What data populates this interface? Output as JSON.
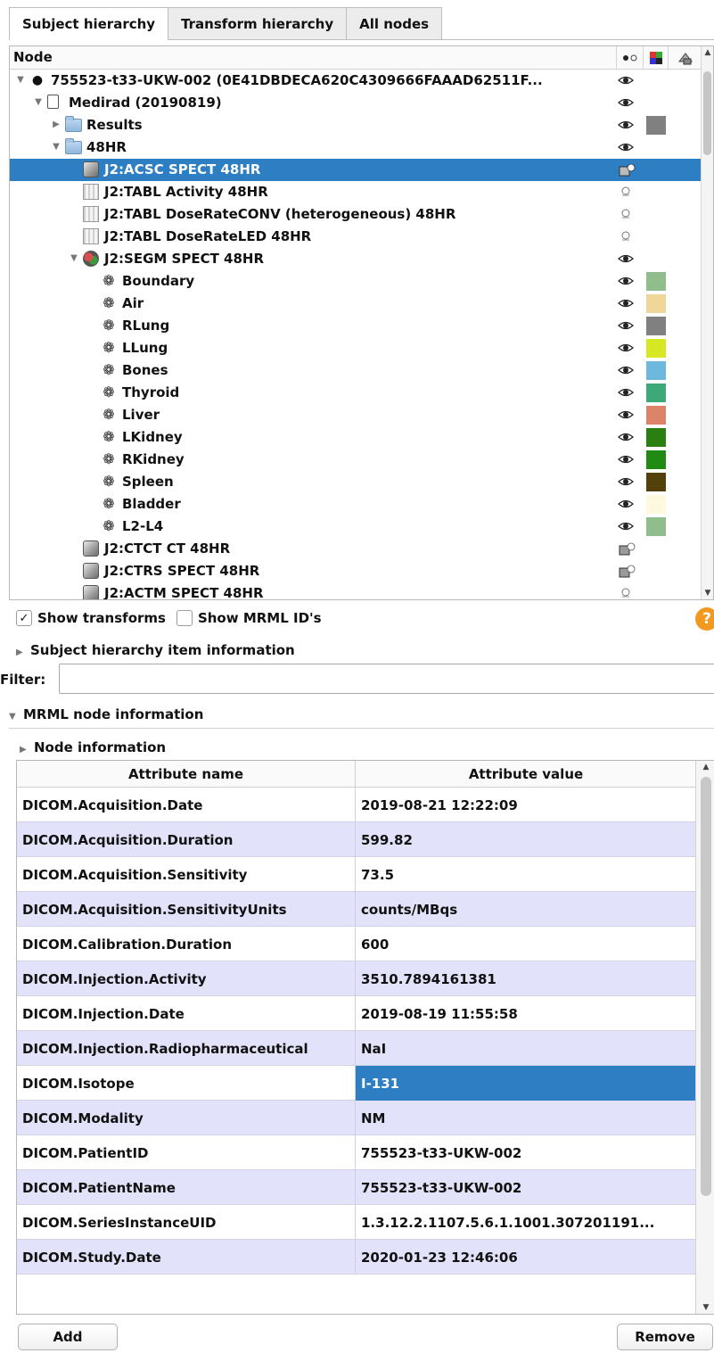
{
  "tabs": [
    {
      "label": "Subject hierarchy",
      "active": true
    },
    {
      "label": "Transform hierarchy",
      "active": false
    },
    {
      "label": "All nodes",
      "active": false
    }
  ],
  "tree": {
    "header": {
      "node": "Node",
      "visibility_icon": "eye-toggle-icon",
      "color_icon": "color-grid-icon",
      "transform_icon": "transform-icon"
    },
    "rows": [
      {
        "label": "755523-t33-UKW-002 (0E41DBDECA620C4309666FAAAD62511F...",
        "icon": "patient-icon",
        "expander": "expanded",
        "indent": 0,
        "vis": "eye-icon"
      },
      {
        "label": "Medirad (20190819)",
        "icon": "study-icon",
        "expander": "expanded",
        "indent": 1,
        "vis": "eye-icon"
      },
      {
        "label": "Results",
        "icon": "folder-icon",
        "expander": "collapsed",
        "indent": 2,
        "vis": "eye-icon",
        "color": "#808080"
      },
      {
        "label": "48HR",
        "icon": "folder-icon",
        "expander": "expanded",
        "indent": 2,
        "vis": "eye-icon"
      },
      {
        "label": "J2:ACSC SPECT 48HR",
        "icon": "volume-icon",
        "expander": "none",
        "indent": 3,
        "vis": "volume-visible-icon",
        "selected": true
      },
      {
        "label": "J2:TABL Activity 48HR",
        "icon": "table-icon",
        "expander": "none",
        "indent": 3,
        "vis": "eye-closed-icon"
      },
      {
        "label": "J2:TABL DoseRateCONV (heterogeneous) 48HR",
        "icon": "table-icon",
        "expander": "none",
        "indent": 3,
        "vis": "eye-closed-icon"
      },
      {
        "label": "J2:TABL DoseRateLED 48HR",
        "icon": "table-icon",
        "expander": "none",
        "indent": 3,
        "vis": "eye-closed-icon"
      },
      {
        "label": "J2:SEGM SPECT 48HR",
        "icon": "segmentation-icon",
        "expander": "expanded",
        "indent": 3,
        "vis": "eye-icon"
      },
      {
        "label": "Boundary",
        "icon": "segment-icon",
        "expander": "none",
        "indent": 4,
        "vis": "eye-icon",
        "color": "#8fbd8b"
      },
      {
        "label": "Air",
        "icon": "segment-icon",
        "expander": "none",
        "indent": 4,
        "vis": "eye-icon",
        "color": "#f1d699"
      },
      {
        "label": "RLung",
        "icon": "segment-icon",
        "expander": "none",
        "indent": 4,
        "vis": "eye-icon",
        "color": "#808080"
      },
      {
        "label": "LLung",
        "icon": "segment-icon",
        "expander": "none",
        "indent": 4,
        "vis": "eye-icon",
        "color": "#d5e823"
      },
      {
        "label": "Bones",
        "icon": "segment-icon",
        "expander": "none",
        "indent": 4,
        "vis": "eye-icon",
        "color": "#6cb8de"
      },
      {
        "label": "Thyroid",
        "icon": "segment-icon",
        "expander": "none",
        "indent": 4,
        "vis": "eye-icon",
        "color": "#3da878"
      },
      {
        "label": "Liver",
        "icon": "segment-icon",
        "expander": "none",
        "indent": 4,
        "vis": "eye-icon",
        "color": "#dd8367"
      },
      {
        "label": "LKidney",
        "icon": "segment-icon",
        "expander": "none",
        "indent": 4,
        "vis": "eye-icon",
        "color": "#2a7e12"
      },
      {
        "label": "RKidney",
        "icon": "segment-icon",
        "expander": "none",
        "indent": 4,
        "vis": "eye-icon",
        "color": "#1f8b13"
      },
      {
        "label": "Spleen",
        "icon": "segment-icon",
        "expander": "none",
        "indent": 4,
        "vis": "eye-icon",
        "color": "#54400a"
      },
      {
        "label": "Bladder",
        "icon": "segment-icon",
        "expander": "none",
        "indent": 4,
        "vis": "eye-icon",
        "color": "#fcf9de"
      },
      {
        "label": "L2-L4",
        "icon": "segment-icon",
        "expander": "none",
        "indent": 4,
        "vis": "eye-icon",
        "color": "#8fbd8b"
      },
      {
        "label": "J2:CTCT CT 48HR",
        "icon": "volume-icon",
        "expander": "none",
        "indent": 3,
        "vis": "volume-hidden-icon"
      },
      {
        "label": "J2:CTRS SPECT 48HR",
        "icon": "volume-icon",
        "expander": "none",
        "indent": 3,
        "vis": "volume-hidden-icon"
      },
      {
        "label": "J2:ACTM SPECT 48HR",
        "icon": "volume-icon",
        "expander": "none",
        "indent": 3,
        "vis": "eye-closed-icon"
      }
    ]
  },
  "options": {
    "show_transforms": {
      "label": "Show transforms",
      "checked": true
    },
    "show_mrml_ids": {
      "label": "Show MRML ID's",
      "checked": false
    },
    "help": "?"
  },
  "sections": {
    "sh_item_info": "Subject hierarchy item information",
    "mrml_node_info": "MRML node information",
    "node_info": "Node information"
  },
  "filter": {
    "label": "Filter:",
    "value": ""
  },
  "attributes": {
    "columns": [
      "Attribute name",
      "Attribute value"
    ],
    "rows": [
      {
        "name": "DICOM.Acquisition.Date",
        "value": "2019-08-21 12:22:09"
      },
      {
        "name": "DICOM.Acquisition.Duration",
        "value": "599.82"
      },
      {
        "name": "DICOM.Acquisition.Sensitivity",
        "value": "73.5"
      },
      {
        "name": "DICOM.Acquisition.SensitivityUnits",
        "value": "counts/MBqs"
      },
      {
        "name": "DICOM.Calibration.Duration",
        "value": "600"
      },
      {
        "name": "DICOM.Injection.Activity",
        "value": "3510.7894161381"
      },
      {
        "name": "DICOM.Injection.Date",
        "value": "2019-08-19 11:55:58"
      },
      {
        "name": "DICOM.Injection.Radiopharmaceutical",
        "value": "NaI"
      },
      {
        "name": "DICOM.Isotope",
        "value": "I-131",
        "selected": true
      },
      {
        "name": "DICOM.Modality",
        "value": "NM"
      },
      {
        "name": "DICOM.PatientID",
        "value": "755523-t33-UKW-002"
      },
      {
        "name": "DICOM.PatientName",
        "value": "755523-t33-UKW-002"
      },
      {
        "name": "DICOM.SeriesInstanceUID",
        "value": "1.3.12.2.1107.5.6.1.1001.307201191..."
      },
      {
        "name": "DICOM.Study.Date",
        "value": "2020-01-23 12:46:06"
      }
    ]
  },
  "buttons": {
    "add": "Add",
    "remove": "Remove"
  },
  "colors": {
    "selection": "#2d7ec2",
    "alt_row": "#e2e2fa",
    "help": "#f29a1f"
  }
}
